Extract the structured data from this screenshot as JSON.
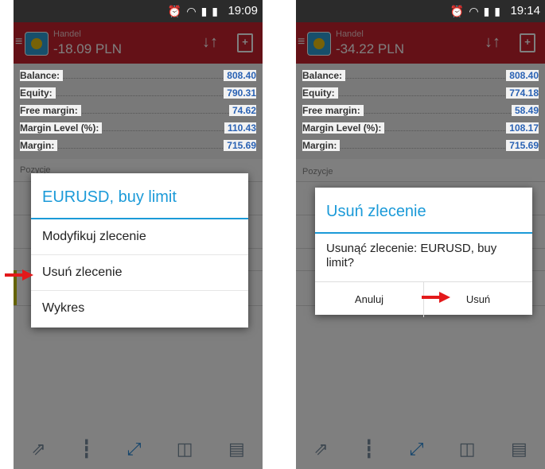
{
  "left": {
    "status": {
      "time": "19:09"
    },
    "appbar": {
      "subtitle": "Handel",
      "amount": "-18.09 PLN"
    },
    "summary": [
      {
        "label": "Balance:",
        "value": "808.40"
      },
      {
        "label": "Equity:",
        "value": "790.31"
      },
      {
        "label": "Free margin:",
        "value": "74.62"
      },
      {
        "label": "Margin Level (%):",
        "value": "110.43"
      },
      {
        "label": "Margin:",
        "value": "715.69"
      }
    ],
    "section": "Pozycje",
    "dialog": {
      "title": "EURUSD, buy limit",
      "items": [
        "Modyfikuj zlecenie",
        "Usuń zlecenie",
        "Wykres"
      ]
    }
  },
  "right": {
    "status": {
      "time": "19:14"
    },
    "appbar": {
      "subtitle": "Handel",
      "amount": "-34.22 PLN"
    },
    "summary": [
      {
        "label": "Balance:",
        "value": "808.40"
      },
      {
        "label": "Equity:",
        "value": "774.18"
      },
      {
        "label": "Free margin:",
        "value": "58.49"
      },
      {
        "label": "Margin Level (%):",
        "value": "108.17"
      },
      {
        "label": "Margin:",
        "value": "715.69"
      }
    ],
    "section": "Pozycje",
    "dialog": {
      "title": "Usuń zlecenie",
      "message": "Usunąć zlecenie: EURUSD, buy limit?",
      "cancel": "Anuluj",
      "confirm": "Usuń"
    }
  },
  "colors": {
    "appbar": "#c8232f",
    "accent": "#1b9ad8",
    "value": "#2a62b4",
    "arrow": "#e3191b"
  },
  "icons": {
    "status": [
      "alarm-icon",
      "wifi-icon",
      "signal-icon",
      "battery-icon"
    ],
    "nav": [
      "quotes-icon",
      "chart-icon",
      "trade-icon",
      "history-icon",
      "news-icon"
    ]
  }
}
